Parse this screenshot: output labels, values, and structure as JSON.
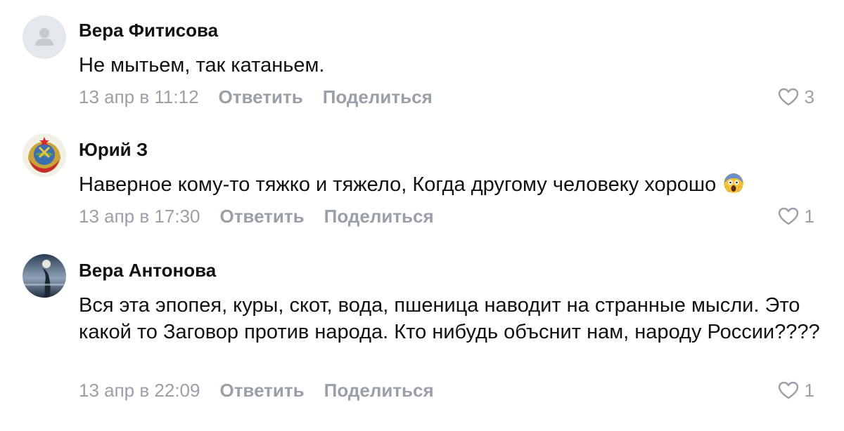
{
  "comments": [
    {
      "author": "Вера Фитисова",
      "text": "Не мытьем, так катаньем.",
      "date": "13 апр в 11:12",
      "reply_label": "Ответить",
      "share_label": "Поделиться",
      "likes": "3",
      "avatar": "placeholder-user-icon"
    },
    {
      "author": "Юрий З",
      "text": "Наверное кому-то тяжко и тяжело, Когда другому человеку хорошо",
      "emoji": "face-screaming-in-fear-emoji",
      "date": "13 апр в 17:30",
      "reply_label": "Ответить",
      "share_label": "Поделиться",
      "likes": "1",
      "avatar": "ussr-emblem"
    },
    {
      "author": "Вера Антонова",
      "text": "Вся эта эпопея, куры, скот, вода, пшеница наводит на странные мысли. Это какой то Заговор против народа. Кто нибудь объснит нам, народу России????",
      "date": "13 апр в 22:09",
      "reply_label": "Ответить",
      "share_label": "Поделиться",
      "likes": "1",
      "avatar": "photo-silhouette"
    }
  ],
  "colors": {
    "meta_gray": "#9aa0a8",
    "text": "#111111",
    "avatar_placeholder_bg": "#e4e7eb",
    "avatar_placeholder_fg": "#c5cad1"
  }
}
